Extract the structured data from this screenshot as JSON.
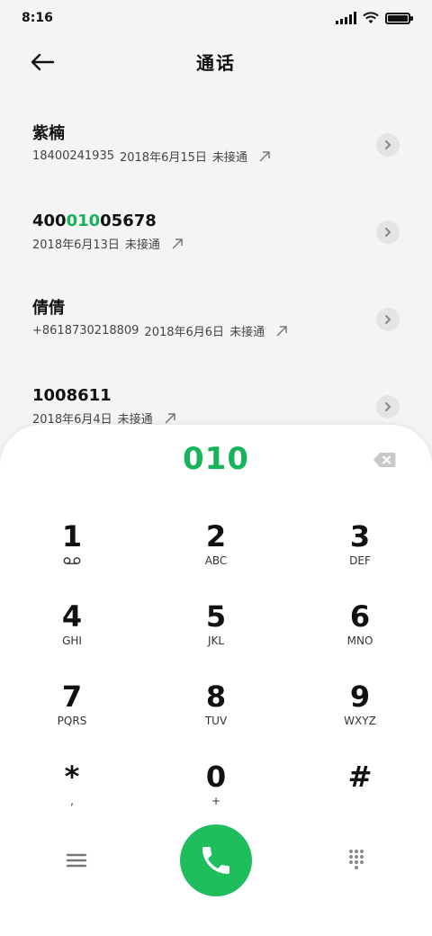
{
  "status_bar": {
    "time": "8:16"
  },
  "header": {
    "title": "通话"
  },
  "calls": [
    {
      "name_prefix": "紫楠",
      "name_highlight": "",
      "name_suffix": "",
      "number": "18400241935",
      "date": "2018年6月15日",
      "status": "未接通"
    },
    {
      "name_prefix": "400",
      "name_highlight": "010",
      "name_suffix": "05678",
      "number": "",
      "date": "2018年6月13日",
      "status": "未接通"
    },
    {
      "name_prefix": "倩倩",
      "name_highlight": "",
      "name_suffix": "",
      "number": "+8618730218809",
      "date": "2018年6月6日",
      "status": "未接通"
    },
    {
      "name_prefix": "1008611",
      "name_highlight": "",
      "name_suffix": "",
      "number": "",
      "date": "2018年6月4日",
      "status": "未接通"
    }
  ],
  "dialpad": {
    "input": "010",
    "keys": [
      {
        "digit": "1",
        "letters": ""
      },
      {
        "digit": "2",
        "letters": "ABC"
      },
      {
        "digit": "3",
        "letters": "DEF"
      },
      {
        "digit": "4",
        "letters": "GHI"
      },
      {
        "digit": "5",
        "letters": "JKL"
      },
      {
        "digit": "6",
        "letters": "MNO"
      },
      {
        "digit": "7",
        "letters": "PQRS"
      },
      {
        "digit": "8",
        "letters": "TUV"
      },
      {
        "digit": "9",
        "letters": "WXYZ"
      },
      {
        "digit": "*",
        "letters": ","
      },
      {
        "digit": "0",
        "letters": "+"
      },
      {
        "digit": "#",
        "letters": ""
      }
    ]
  },
  "colors": {
    "accent": "#1fbe5d",
    "highlight_text": "#17b45b"
  },
  "icons": [
    "back-arrow-icon",
    "chevron-right-icon",
    "outgoing-arrow-icon",
    "backspace-icon",
    "voicemail-icon",
    "menu-icon",
    "phone-icon",
    "dialpad-icon"
  ]
}
